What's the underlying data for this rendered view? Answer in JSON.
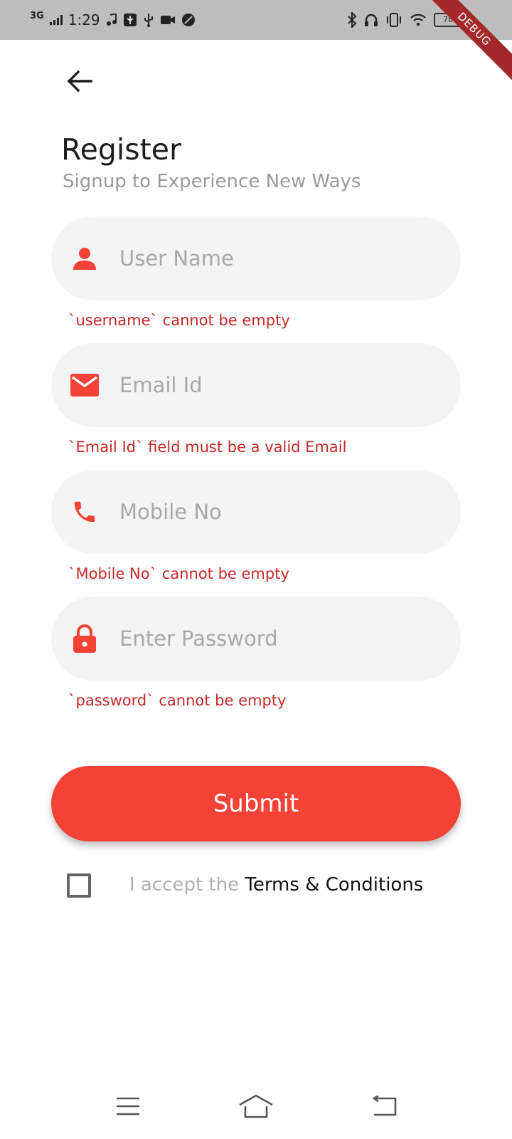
{
  "status_bar": {
    "network": "3G",
    "time": "1:29",
    "battery": "78"
  },
  "debug_banner": "DEBUG",
  "header": {
    "title": "Register",
    "subtitle": "Signup to Experience New Ways"
  },
  "form": {
    "fields": [
      {
        "icon": "person-icon",
        "placeholder": "User Name",
        "value": "",
        "error": "`username` cannot be empty"
      },
      {
        "icon": "mail-icon",
        "placeholder": "Email Id",
        "value": "",
        "error": "`Email Id` field must be a valid Email"
      },
      {
        "icon": "phone-icon",
        "placeholder": "Mobile No",
        "value": "",
        "error": "`Mobile No` cannot be empty"
      },
      {
        "icon": "lock-icon",
        "placeholder": "Enter Password",
        "value": "",
        "error": "`password` cannot be empty"
      }
    ],
    "submit_label": "Submit",
    "terms_checked": false,
    "terms_prefix": "I accept the ",
    "terms_link": "Terms & Conditions"
  },
  "colors": {
    "accent": "#f44336",
    "error": "#c62828",
    "field_background": "#f4f4f4",
    "status_bar": "#bdbdbd"
  },
  "nav_bar": {
    "icons": [
      "menu-icon",
      "home-icon",
      "back-nav-icon"
    ]
  }
}
